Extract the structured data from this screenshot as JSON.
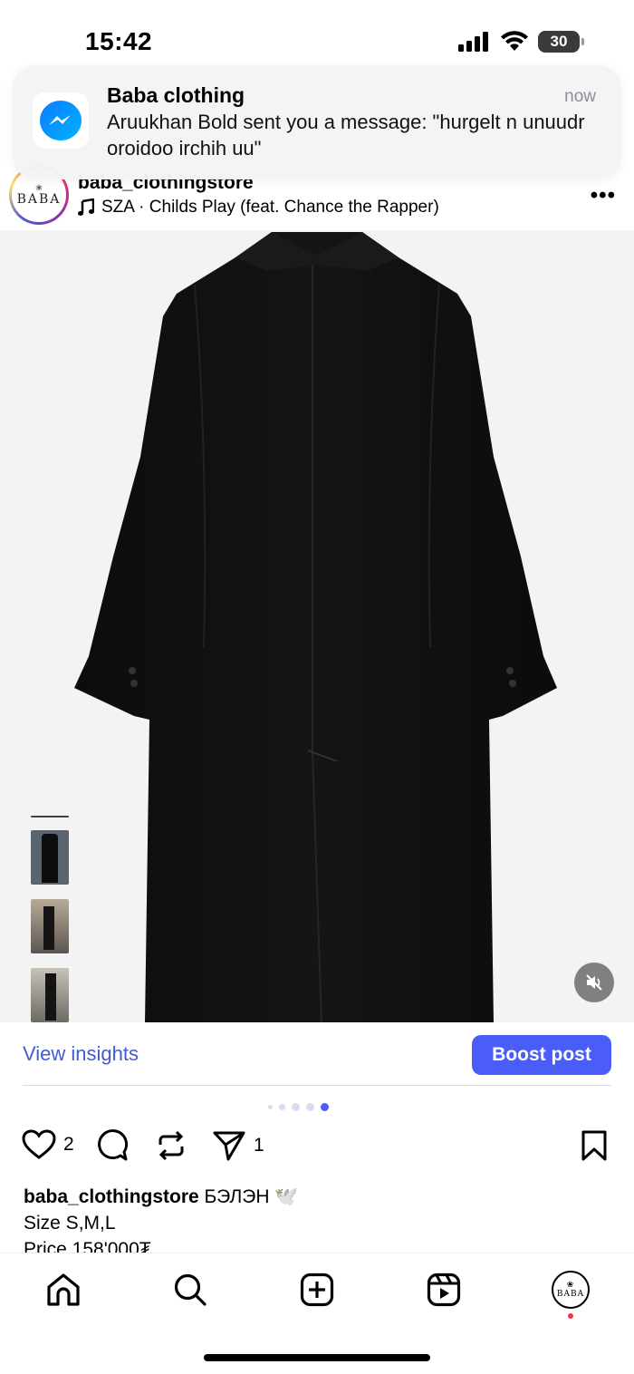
{
  "status_bar": {
    "time": "15:42",
    "battery": "30"
  },
  "notification": {
    "app": "Baba clothing",
    "time": "now",
    "body": "Aruukhan Bold sent you a message: \"hurgelt n unuudr oroidoo irchih uu\""
  },
  "post": {
    "username": "baba_clothingstore",
    "music": "SZA · Childs Play (feat. Chance the Rapper)",
    "avatar_text": "BABA",
    "likes": "2",
    "shares": "1",
    "carousel": {
      "count": 5,
      "active_index": 4
    }
  },
  "insights": {
    "view_label": "View insights",
    "boost_label": "Boost post"
  },
  "caption": {
    "username": "baba_clothingstore",
    "line1": "БЭЛЭН 🕊️",
    "line2": "Size S,M,L",
    "line3": "Price 158'000₮"
  },
  "colors": {
    "accent": "#4a5df9",
    "link": "#3f5bd6",
    "notification_badge": "#ff2d3f"
  },
  "icons": {
    "nav": [
      "home-icon",
      "search-icon",
      "create-icon",
      "reels-icon",
      "profile-avatar"
    ]
  }
}
